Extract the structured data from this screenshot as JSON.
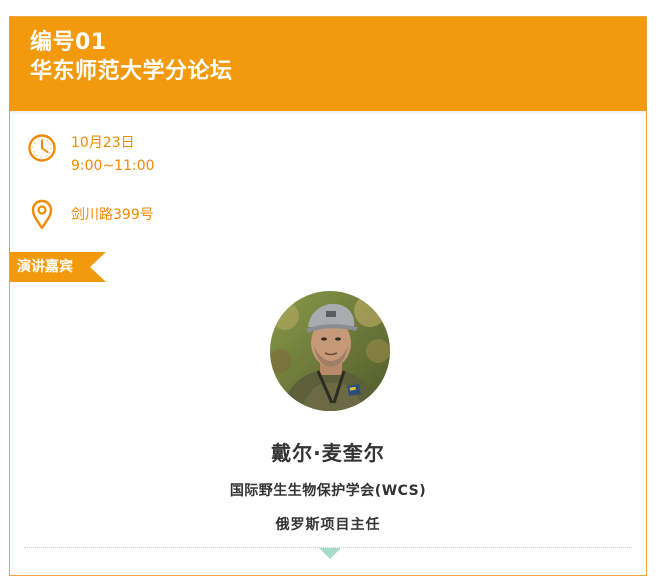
{
  "header": {
    "code": "编号01",
    "title": "华东师范大学分论坛"
  },
  "schedule": {
    "date": "10月23日",
    "time": "9:00~11:00",
    "address": "剑川路399号"
  },
  "section": {
    "label": "演讲嘉宾"
  },
  "speaker": {
    "name": "戴尔·麦奎尔",
    "organization": "国际野生生物保护学会(WCS)",
    "position": "俄罗斯项目主任"
  },
  "colors": {
    "accent": "#f39a0c",
    "accent_text": "#f08a00",
    "arrow": "#a8dcc8"
  },
  "icons": {
    "clock": "clock-icon",
    "location": "location-pin-icon",
    "expand": "chevron-down-icon"
  }
}
